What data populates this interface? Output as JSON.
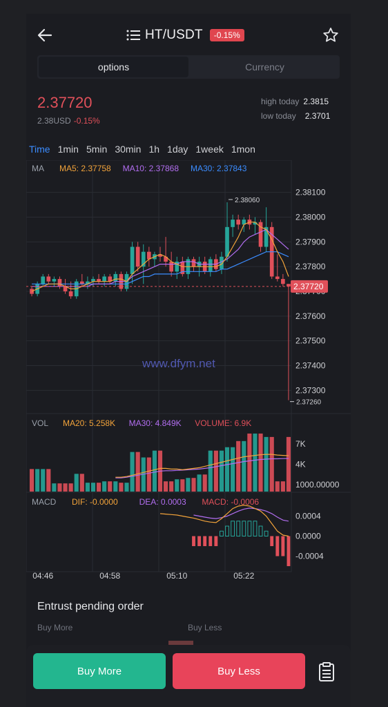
{
  "header": {
    "title": "HT/USDT",
    "change_badge": "-0.15%",
    "icons": {
      "back": "arrow-left-icon",
      "menu": "list-icon",
      "favorite": "star-icon"
    }
  },
  "tabs": [
    {
      "label": "options",
      "active": true
    },
    {
      "label": "Currency",
      "active": false
    }
  ],
  "ticker": {
    "price": "2.37720",
    "usd": "2.38USD",
    "change": "-0.15%",
    "high_label": "high today",
    "high_value": "2.3815",
    "low_label": "low today",
    "low_value": "2.3701"
  },
  "periods": [
    {
      "label": "Time",
      "active": true
    },
    {
      "label": "1min"
    },
    {
      "label": "5min"
    },
    {
      "label": "30min"
    },
    {
      "label": "1h"
    },
    {
      "label": "1day"
    },
    {
      "label": "1week"
    },
    {
      "label": "1mon"
    }
  ],
  "chart_data": {
    "type": "candlestick",
    "ma_legend": [
      {
        "label": "MA",
        "color": "#9aa0aa"
      },
      {
        "label": "MA5: 2.37758",
        "color": "#f2a33a"
      },
      {
        "label": "MA10: 2.37868",
        "color": "#b26ef0"
      },
      {
        "label": "MA30: 2.37843",
        "color": "#3b8cff"
      }
    ],
    "price_ticks": [
      "2.38100",
      "2.38000",
      "2.37900",
      "2.37800",
      "2.37700",
      "2.37600",
      "2.37500",
      "2.37400",
      "2.37300"
    ],
    "price_tick_values": [
      2.381,
      2.38,
      2.379,
      2.378,
      2.377,
      2.376,
      2.375,
      2.374,
      2.373
    ],
    "ylim": [
      2.3722,
      2.3818
    ],
    "current_price": "2.37720",
    "current_price_value": 2.3772,
    "high_annotation": "2.38060",
    "high_value": 2.3806,
    "low_annotation": "2.37260",
    "low_value": 2.3726,
    "watermark": "www.dfym.net",
    "candles": [
      [
        2.3771,
        2.3772,
        2.3768,
        2.3769
      ],
      [
        2.3769,
        2.3774,
        2.3768,
        2.3773
      ],
      [
        2.3773,
        2.3777,
        2.3772,
        2.3776
      ],
      [
        2.3776,
        2.3777,
        2.3773,
        2.3774
      ],
      [
        2.3774,
        2.3776,
        2.3772,
        2.3775
      ],
      [
        2.3775,
        2.3776,
        2.3771,
        2.3772
      ],
      [
        2.3772,
        2.3775,
        2.3769,
        2.377
      ],
      [
        2.377,
        2.3774,
        2.3767,
        2.3768
      ],
      [
        2.3768,
        2.3775,
        2.3767,
        2.3774
      ],
      [
        2.3774,
        2.3777,
        2.3772,
        2.3773
      ],
      [
        2.3773,
        2.3776,
        2.3771,
        2.3774
      ],
      [
        2.3774,
        2.3776,
        2.3772,
        2.3775
      ],
      [
        2.3775,
        2.3777,
        2.3773,
        2.3774
      ],
      [
        2.3774,
        2.3777,
        2.3772,
        2.3776
      ],
      [
        2.3776,
        2.3777,
        2.3773,
        2.3774
      ],
      [
        2.3774,
        2.3778,
        2.3772,
        2.3777
      ],
      [
        2.3777,
        2.3778,
        2.377,
        2.3771
      ],
      [
        2.3771,
        2.3778,
        2.377,
        2.3777
      ],
      [
        2.3777,
        2.379,
        2.3773,
        2.3788
      ],
      [
        2.3788,
        2.379,
        2.3778,
        2.378
      ],
      [
        2.378,
        2.3789,
        2.3773,
        2.3786
      ],
      [
        2.3786,
        2.3788,
        2.378,
        2.3783
      ],
      [
        2.3783,
        2.3786,
        2.378,
        2.3785
      ],
      [
        2.3785,
        2.3788,
        2.3782,
        2.3784
      ],
      [
        2.3784,
        2.3792,
        2.378,
        2.3782
      ],
      [
        2.3782,
        2.3786,
        2.3776,
        2.3778
      ],
      [
        2.3778,
        2.3784,
        2.3775,
        2.3782
      ],
      [
        2.3782,
        2.3784,
        2.3776,
        2.3777
      ],
      [
        2.3777,
        2.3784,
        2.3775,
        2.3783
      ],
      [
        2.3783,
        2.3784,
        2.3778,
        2.378
      ],
      [
        2.378,
        2.3784,
        2.3776,
        2.3782
      ],
      [
        2.3782,
        2.3784,
        2.3777,
        2.3778
      ],
      [
        2.3778,
        2.3784,
        2.3776,
        2.3783
      ],
      [
        2.3783,
        2.3785,
        2.3778,
        2.3779
      ],
      [
        2.3779,
        2.3786,
        2.3777,
        2.3784
      ],
      [
        2.3784,
        2.3806,
        2.3782,
        2.3796
      ],
      [
        2.3796,
        2.3801,
        2.3792,
        2.3799
      ],
      [
        2.3799,
        2.3801,
        2.3795,
        2.3797
      ],
      [
        2.3797,
        2.38,
        2.3794,
        2.3799
      ],
      [
        2.3799,
        2.3801,
        2.3795,
        2.3797
      ],
      [
        2.3797,
        2.38,
        2.3793,
        2.3798
      ],
      [
        2.3798,
        2.3799,
        2.3786,
        2.3788
      ],
      [
        2.3788,
        2.3804,
        2.3786,
        2.3796
      ],
      [
        2.3796,
        2.3798,
        2.3775,
        2.3776
      ],
      [
        2.3776,
        2.3785,
        2.3774,
        2.3775
      ],
      [
        2.3775,
        2.3777,
        2.3772,
        2.3773
      ],
      [
        2.3773,
        2.3773,
        2.3726,
        2.3772
      ]
    ],
    "ma5": [
      2.377,
      2.3771,
      2.3772,
      2.3773,
      2.3773,
      2.3773,
      2.3772,
      2.3771,
      2.3771,
      2.3772,
      2.3773,
      2.3774,
      2.3774,
      2.3774,
      2.3774,
      2.3775,
      2.3775,
      2.3774,
      2.3777,
      2.3779,
      2.3781,
      2.3783,
      2.3784,
      2.3785,
      2.3784,
      2.3782,
      2.3781,
      2.378,
      2.378,
      2.378,
      2.378,
      2.378,
      2.378,
      2.378,
      2.3781,
      2.3784,
      2.3788,
      2.3792,
      2.3797,
      2.3798,
      2.3798,
      2.3796,
      2.3795,
      2.3791,
      2.3786,
      2.3782,
      2.3776
    ],
    "ma10": [
      2.3772,
      2.3772,
      2.3772,
      2.3772,
      2.3772,
      2.3772,
      2.3772,
      2.3772,
      2.3772,
      2.3772,
      2.3772,
      2.3773,
      2.3773,
      2.3773,
      2.3773,
      2.3774,
      2.3774,
      2.3774,
      2.3776,
      2.3777,
      2.3778,
      2.3779,
      2.378,
      2.3781,
      2.3781,
      2.3781,
      2.3781,
      2.3782,
      2.3782,
      2.3782,
      2.3781,
      2.3781,
      2.3781,
      2.3781,
      2.3782,
      2.3783,
      2.3785,
      2.3787,
      2.379,
      2.3792,
      2.3793,
      2.3794,
      2.3795,
      2.3793,
      2.3791,
      2.3789,
      2.3787
    ],
    "ma30": [
      2.3773,
      2.3773,
      2.3773,
      2.3773,
      2.3773,
      2.3773,
      2.3773,
      2.3773,
      2.3773,
      2.3773,
      2.3773,
      2.3773,
      2.3773,
      2.3773,
      2.3773,
      2.3773,
      2.3773,
      2.3773,
      2.3774,
      2.3775,
      2.3776,
      2.3776,
      2.3777,
      2.3777,
      2.3777,
      2.3777,
      2.3777,
      2.3778,
      2.3778,
      2.3778,
      2.3778,
      2.3778,
      2.3778,
      2.3778,
      2.3779,
      2.3779,
      2.378,
      2.3781,
      2.3782,
      2.3783,
      2.3784,
      2.3785,
      2.3786,
      2.3786,
      2.3786,
      2.3785,
      2.3784
    ],
    "volume": {
      "legend": [
        {
          "label": "VOL",
          "color": "#9aa0aa"
        },
        {
          "label": "MA20: 5.258K",
          "color": "#f2a33a"
        },
        {
          "label": "MA30: 4.849K",
          "color": "#b26ef0"
        },
        {
          "label": "VOLUME: 6.9K",
          "color": "#e0505a"
        }
      ],
      "ticks": [
        "7K",
        "4K",
        "1000.00000"
      ],
      "tick_values": [
        7000,
        4000,
        1000
      ],
      "ylim": [
        0,
        9000
      ],
      "values": [
        3300,
        3300,
        3300,
        3300,
        1200,
        1200,
        1200,
        1200,
        2600,
        2600,
        1300,
        1300,
        1300,
        1500,
        1500,
        1500,
        1300,
        1300,
        5800,
        5800,
        5000,
        5000,
        6000,
        6000,
        1500,
        1500,
        1800,
        1800,
        2000,
        2000,
        2500,
        2500,
        6000,
        6000,
        6000,
        6500,
        6500,
        7400,
        7400,
        8500,
        8500,
        8500,
        8000,
        8000,
        1500,
        1500,
        8000
      ],
      "ma20": [
        null,
        null,
        null,
        null,
        null,
        null,
        null,
        null,
        null,
        null,
        null,
        null,
        null,
        null,
        null,
        2100,
        2100,
        2200,
        2400,
        2600,
        2800,
        3000,
        3200,
        3400,
        3400,
        3300,
        3300,
        3200,
        3300,
        3400,
        3500,
        3700,
        3900,
        4100,
        4300,
        4500,
        4700,
        4900,
        5100,
        5200,
        5300,
        5400,
        5450,
        5450,
        5350,
        5300,
        5258
      ],
      "ma30": [
        null,
        null,
        null,
        null,
        null,
        null,
        null,
        null,
        null,
        null,
        null,
        null,
        null,
        null,
        null,
        2000,
        2000,
        2100,
        2250,
        2400,
        2550,
        2700,
        2850,
        3000,
        3050,
        3050,
        3100,
        3150,
        3200,
        3250,
        3300,
        3400,
        3500,
        3650,
        3800,
        3950,
        4100,
        4250,
        4400,
        4500,
        4600,
        4700,
        4750,
        4800,
        4800,
        4830,
        4849
      ]
    },
    "macd": {
      "legend": [
        {
          "label": "MACD",
          "color": "#9aa0aa"
        },
        {
          "label": "DIF: -0.0000",
          "color": "#f2a33a"
        },
        {
          "label": "DEA: 0.0003",
          "color": "#b26ef0"
        },
        {
          "label": "MACD: -0.0006",
          "color": "#e0505a"
        }
      ],
      "ticks": [
        "0.0004",
        "0.0000",
        "-0.0004"
      ],
      "tick_values": [
        0.0004,
        0.0,
        -0.0004
      ],
      "ylim": [
        -0.0006,
        0.0006
      ],
      "hist": [
        null,
        null,
        null,
        null,
        null,
        null,
        null,
        null,
        null,
        null,
        null,
        null,
        null,
        null,
        null,
        null,
        null,
        null,
        null,
        null,
        null,
        null,
        null,
        null,
        null,
        null,
        null,
        null,
        null,
        -0.0002,
        -0.0002,
        -0.0002,
        -0.0002,
        -0.0002,
        0.0001,
        0.0002,
        0.0003,
        0.0003,
        0.0003,
        0.0003,
        0.0003,
        0.0002,
        0.0001,
        -0.0002,
        -0.0004,
        -0.0004,
        -0.0006
      ],
      "dif": [
        null,
        null,
        null,
        null,
        null,
        null,
        null,
        null,
        null,
        null,
        null,
        null,
        null,
        null,
        null,
        null,
        null,
        null,
        null,
        null,
        null,
        null,
        null,
        0.00045,
        0.00044,
        0.00043,
        0.00042,
        0.0004,
        0.00038,
        0.00036,
        0.00033,
        0.0003,
        0.00028,
        0.00027,
        0.00035,
        0.00045,
        0.00055,
        0.0006,
        0.00062,
        0.0006,
        0.00055,
        0.0005,
        0.0004,
        0.00025,
        0.0001,
        2e-05,
        0.0
      ],
      "dea": [
        null,
        null,
        null,
        null,
        null,
        null,
        null,
        null,
        null,
        null,
        null,
        null,
        null,
        null,
        null,
        null,
        null,
        null,
        null,
        null,
        null,
        null,
        null,
        null,
        null,
        null,
        null,
        null,
        null,
        0.00042,
        0.0004,
        0.00038,
        0.00036,
        0.00035,
        0.00037,
        0.0004,
        0.00045,
        0.0005,
        0.00054,
        0.00056,
        0.00055,
        0.00053,
        0.0005,
        0.00045,
        0.00038,
        0.00032,
        0.0003
      ]
    },
    "time_labels": [
      {
        "label": "04:46",
        "index": 2
      },
      {
        "label": "04:58",
        "index": 14
      },
      {
        "label": "05:10",
        "index": 26
      },
      {
        "label": "05:22",
        "index": 38
      }
    ]
  },
  "orders": {
    "title": "Entrust pending order",
    "buy_label": "Buy More",
    "sell_label": "Buy Less"
  },
  "actions": {
    "buy": "Buy More",
    "sell": "Buy Less",
    "orders_icon": "clipboard-list-icon"
  },
  "colors": {
    "up": "#26a69a",
    "down": "#e0505a",
    "accent": "#3b8cff",
    "buy": "#23b68f",
    "sell": "#e8445a"
  }
}
